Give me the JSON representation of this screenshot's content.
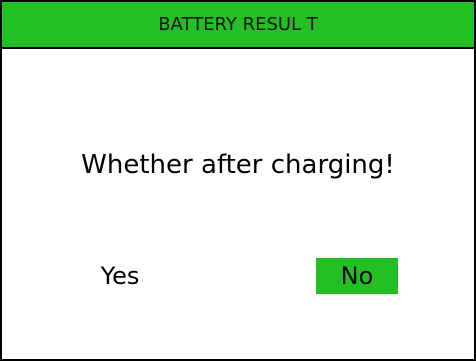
{
  "header": {
    "title": "BATTERY RESUL T"
  },
  "dialog": {
    "message": "Whether after charging!",
    "options": [
      {
        "label": "Yes",
        "selected": false
      },
      {
        "label": "No",
        "selected": true
      }
    ]
  },
  "colors": {
    "accent": "#22c022",
    "text": "#000000",
    "background": "#ffffff"
  }
}
